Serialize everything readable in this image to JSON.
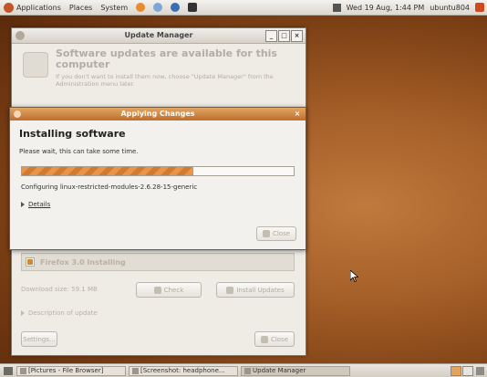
{
  "top_panel": {
    "applications": "Applications",
    "places": "Places",
    "system": "System",
    "clock": "Wed 19 Aug, 1:44 PM",
    "user": "ubuntu804"
  },
  "update_manager": {
    "title": "Update Manager",
    "header_title": "Software updates are available for this computer",
    "header_text": "If you don't want to install them now, choose \"Update Manager\" from the Administration menu later.",
    "list_item": "Firefox 3.0 Installing",
    "download_size_label": "Download size: 59.1 MB",
    "check_button": "Check",
    "install_button": "Install Updates",
    "description_label": "Description of update",
    "settings_button": "Settings...",
    "close_button": "Close"
  },
  "dialog": {
    "title": "Applying Changes",
    "heading": "Installing software",
    "message": "Please wait, this can take some time.",
    "progress": 0.63,
    "status": "Configuring linux-restricted-modules-2.6.28-15-generic",
    "details_label": "Details",
    "close_button": "Close"
  },
  "bottom_panel": {
    "tasks": [
      {
        "label": "[Pictures - File Browser]"
      },
      {
        "label": "[Screenshot: headphone..."
      },
      {
        "label": "Update Manager"
      }
    ]
  },
  "colors": {
    "accent": "#d17a32",
    "dialog_titlebar": "#c06d2a",
    "desktop": "#a45e27"
  }
}
